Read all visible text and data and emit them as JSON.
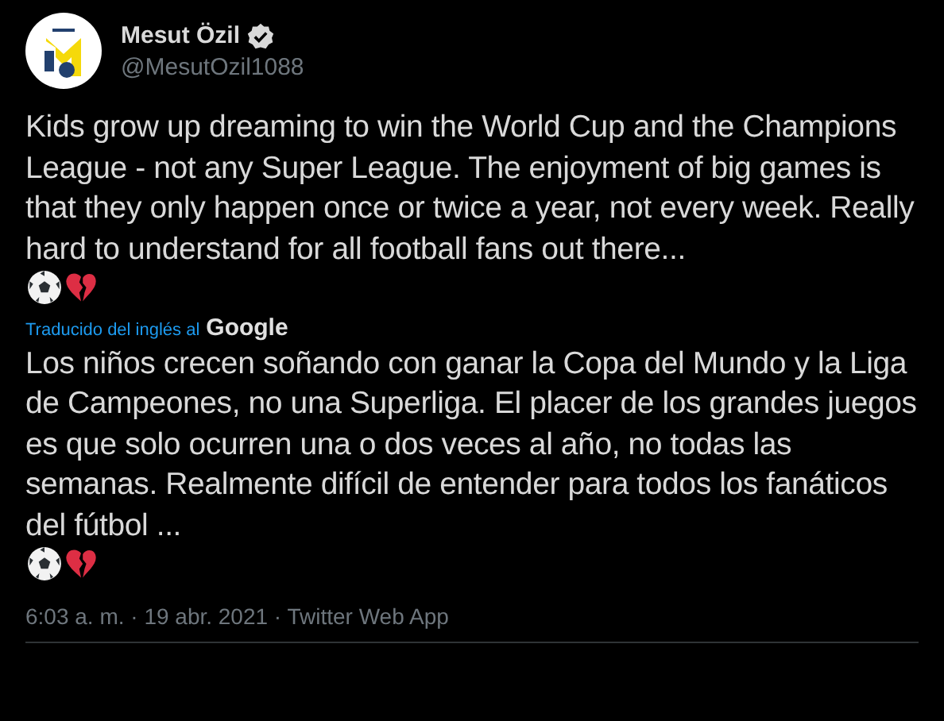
{
  "author": {
    "name": "Mesut Özil",
    "verified": true,
    "handle": "@MesutOzil1088"
  },
  "tweet": {
    "text": "Kids grow up dreaming to win the World Cup and the Champions League - not any Super League. The enjoyment of big games is that they only happen once or twice a year, not every week. Really hard to understand for all football fans out there...",
    "translation_label": "Traducido del inglés al",
    "translation_brand": "Google",
    "translated_text": "Los niños crecen soñando con ganar la Copa del Mundo y la Liga de Campeones, no una Superliga. El placer de los grandes juegos es que solo ocurren una o dos veces al año, no todas las semanas. Realmente difícil de entender para todos los fanáticos del fútbol ...",
    "meta": "6:03 a. m. · 19 abr. 2021 · Twitter Web App"
  }
}
